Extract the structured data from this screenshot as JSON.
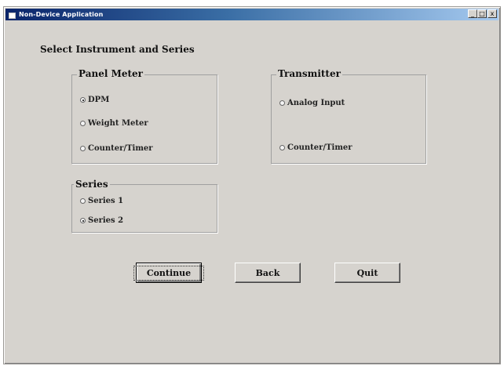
{
  "window": {
    "title": "Non-Device Application",
    "controls": [
      "_",
      "□",
      "x"
    ]
  },
  "heading": "Select Instrument and Series",
  "panel_meter": {
    "legend": "Panel Meter",
    "options": [
      {
        "label": "DPM",
        "checked": true
      },
      {
        "label": "Weight Meter",
        "checked": false
      },
      {
        "label": "Counter/Timer",
        "checked": false
      }
    ]
  },
  "transmitter": {
    "legend": "Transmitter",
    "options": [
      {
        "label": "Analog Input",
        "checked": false
      },
      {
        "label": "Counter/Timer",
        "checked": false
      }
    ]
  },
  "series": {
    "legend": "Series",
    "options": [
      {
        "label": "Series 1",
        "checked": false
      },
      {
        "label": "Series 2",
        "checked": true
      }
    ]
  },
  "buttons": {
    "continue": "Continue",
    "back": "Back",
    "quit": "Quit"
  },
  "colors": {
    "window_bg": "#d6d3ce",
    "titlebar_start": "#0a246a",
    "titlebar_end": "#a6caf0"
  }
}
